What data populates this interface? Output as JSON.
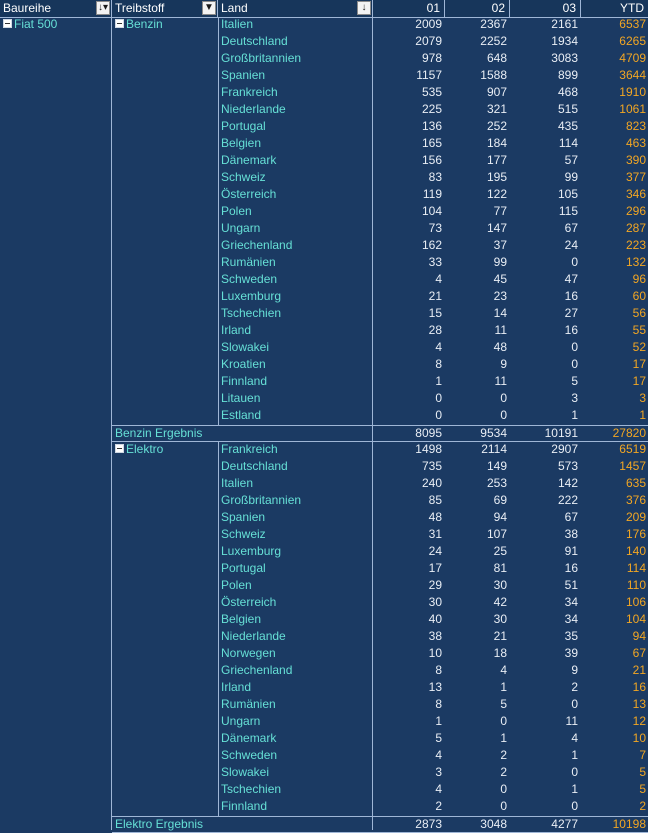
{
  "headers": {
    "baureihe": "Baureihe",
    "treibstoff": "Treibstoff",
    "land": "Land",
    "m01": "01",
    "m02": "02",
    "m03": "03",
    "ytd": "YTD"
  },
  "baureihe": "Fiat 500",
  "groups": {
    "benzin": {
      "label": "Benzin",
      "rows": [
        [
          "Italien",
          "2009",
          "2367",
          "2161",
          "6537"
        ],
        [
          "Deutschland",
          "2079",
          "2252",
          "1934",
          "6265"
        ],
        [
          "Großbritannien",
          "978",
          "648",
          "3083",
          "4709"
        ],
        [
          "Spanien",
          "1157",
          "1588",
          "899",
          "3644"
        ],
        [
          "Frankreich",
          "535",
          "907",
          "468",
          "1910"
        ],
        [
          "Niederlande",
          "225",
          "321",
          "515",
          "1061"
        ],
        [
          "Portugal",
          "136",
          "252",
          "435",
          "823"
        ],
        [
          "Belgien",
          "165",
          "184",
          "114",
          "463"
        ],
        [
          "Dänemark",
          "156",
          "177",
          "57",
          "390"
        ],
        [
          "Schweiz",
          "83",
          "195",
          "99",
          "377"
        ],
        [
          "Österreich",
          "119",
          "122",
          "105",
          "346"
        ],
        [
          "Polen",
          "104",
          "77",
          "115",
          "296"
        ],
        [
          "Ungarn",
          "73",
          "147",
          "67",
          "287"
        ],
        [
          "Griechenland",
          "162",
          "37",
          "24",
          "223"
        ],
        [
          "Rumänien",
          "33",
          "99",
          "0",
          "132"
        ],
        [
          "Schweden",
          "4",
          "45",
          "47",
          "96"
        ],
        [
          "Luxemburg",
          "21",
          "23",
          "16",
          "60"
        ],
        [
          "Tschechien",
          "15",
          "14",
          "27",
          "56"
        ],
        [
          "Irland",
          "28",
          "11",
          "16",
          "55"
        ],
        [
          "Slowakei",
          "4",
          "48",
          "0",
          "52"
        ],
        [
          "Kroatien",
          "8",
          "9",
          "0",
          "17"
        ],
        [
          "Finnland",
          "1",
          "11",
          "5",
          "17"
        ],
        [
          "Litauen",
          "0",
          "0",
          "3",
          "3"
        ],
        [
          "Estland",
          "0",
          "0",
          "1",
          "1"
        ]
      ],
      "total_label": "Benzin Ergebnis",
      "total": [
        "8095",
        "9534",
        "10191",
        "27820"
      ]
    },
    "elektro": {
      "label": "Elektro",
      "rows": [
        [
          "Frankreich",
          "1498",
          "2114",
          "2907",
          "6519"
        ],
        [
          "Deutschland",
          "735",
          "149",
          "573",
          "1457"
        ],
        [
          "Italien",
          "240",
          "253",
          "142",
          "635"
        ],
        [
          "Großbritannien",
          "85",
          "69",
          "222",
          "376"
        ],
        [
          "Spanien",
          "48",
          "94",
          "67",
          "209"
        ],
        [
          "Schweiz",
          "31",
          "107",
          "38",
          "176"
        ],
        [
          "Luxemburg",
          "24",
          "25",
          "91",
          "140"
        ],
        [
          "Portugal",
          "17",
          "81",
          "16",
          "114"
        ],
        [
          "Polen",
          "29",
          "30",
          "51",
          "110"
        ],
        [
          "Österreich",
          "30",
          "42",
          "34",
          "106"
        ],
        [
          "Belgien",
          "40",
          "30",
          "34",
          "104"
        ],
        [
          "Niederlande",
          "38",
          "21",
          "35",
          "94"
        ],
        [
          "Norwegen",
          "10",
          "18",
          "39",
          "67"
        ],
        [
          "Griechenland",
          "8",
          "4",
          "9",
          "21"
        ],
        [
          "Irland",
          "13",
          "1",
          "2",
          "16"
        ],
        [
          "Rumänien",
          "8",
          "5",
          "0",
          "13"
        ],
        [
          "Ungarn",
          "1",
          "0",
          "11",
          "12"
        ],
        [
          "Dänemark",
          "5",
          "1",
          "4",
          "10"
        ],
        [
          "Schweden",
          "4",
          "2",
          "1",
          "7"
        ],
        [
          "Slowakei",
          "3",
          "2",
          "0",
          "5"
        ],
        [
          "Tschechien",
          "4",
          "0",
          "1",
          "5"
        ],
        [
          "Finnland",
          "2",
          "0",
          "0",
          "2"
        ]
      ],
      "total_label": "Elektro Ergebnis",
      "total": [
        "2873",
        "3048",
        "4277",
        "10198"
      ]
    }
  },
  "colors": {
    "background": "#1b3a63",
    "land_text": "#66e0d6",
    "ytd_text": "#f2a623",
    "grid": "#9fb6d6"
  }
}
